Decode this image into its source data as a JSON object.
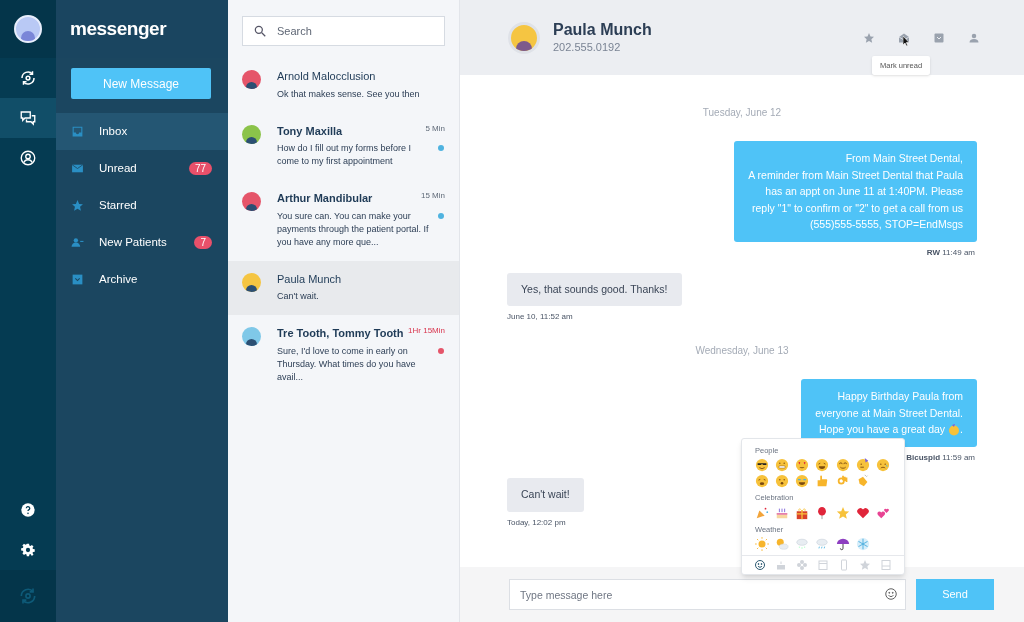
{
  "rail": {
    "items": [
      {
        "kind": "sync",
        "selected": false
      },
      {
        "kind": "chat",
        "selected": true
      },
      {
        "kind": "profile",
        "selected": false
      }
    ],
    "bottom": [
      {
        "kind": "help"
      },
      {
        "kind": "settings"
      }
    ]
  },
  "nav": {
    "logo": "messenger",
    "new_button": "New Message",
    "items": [
      {
        "kind": "inbox",
        "label": "Inbox",
        "selected": true
      },
      {
        "kind": "unread",
        "label": "Unread",
        "badge": "77",
        "selected": false
      },
      {
        "kind": "starred",
        "label": "Starred",
        "selected": false
      },
      {
        "kind": "patients",
        "label": "New Patients",
        "badge": "7",
        "selected": false
      },
      {
        "kind": "archive",
        "label": "Archive",
        "selected": false
      }
    ]
  },
  "conversations": {
    "search": {
      "placeholder": "Search"
    },
    "items": [
      {
        "name": "Arnold Malocclusion",
        "preview": "Ok that makes sense. See you then",
        "color": "#e5556a",
        "unread": false,
        "selected": false
      },
      {
        "name": "Tony Maxilla",
        "preview": "How do I fill out my forms before I come to my first appointment",
        "time": "5 Min",
        "time_urgent": false,
        "color": "#8bc34a",
        "unread": true,
        "unread_dot": {
          "color": "#4fb3e0"
        },
        "selected": false
      },
      {
        "name": "Arthur Mandibular",
        "preview": "You sure can. You can make your payments through the patient portal. If you have any more que...",
        "time": "15 Min",
        "time_urgent": false,
        "color": "#e5556a",
        "unread": true,
        "unread_dot": {
          "color": "#4fb3e0"
        },
        "selected": false
      },
      {
        "name": "Paula Munch",
        "preview": "Can't wait.",
        "color": "#f5c542",
        "unread": false,
        "selected": true
      },
      {
        "name": "Tre Tooth, Tommy Tooth",
        "preview": "Sure, I'd love to come in early on Thursday. What times do you have avail...",
        "time": "1Hr 15Min",
        "color": "#7fc8e8",
        "unread": true,
        "unread_dot": {
          "color": "#e5556a"
        },
        "time_urgent": true,
        "selected": false
      }
    ]
  },
  "chat": {
    "contact": {
      "name": "Paula Munch",
      "phone": "202.555.0192"
    },
    "actions": [
      {
        "kind": "star"
      },
      {
        "kind": "mark-unread"
      },
      {
        "kind": "archive"
      },
      {
        "kind": "profile"
      }
    ],
    "tooltip": "Mark unread",
    "messages": [
      {
        "kind": "date",
        "text": "Tuesday, June 12"
      },
      {
        "kind": "out",
        "lines": [
          "From Main Street Dental,",
          "A reminder from Main Street Dental that Paula",
          "has an appt on June 11 at 1:40PM. Please",
          "reply \"1\" to confirm or  \"2\" to get a call from us",
          "(555)555-5555, STOP=EndMsgs"
        ],
        "sender": "RW",
        "time": "11:49 am"
      },
      {
        "kind": "in",
        "text": "Yes, that sounds good. Thanks!",
        "time": "June 10, 11:52 am"
      },
      {
        "kind": "date",
        "text": "Wednesday, June 13"
      },
      {
        "kind": "out",
        "lines": [
          "Happy Birthday Paula from",
          "everyone at Main Street Dental.",
          "Hope you have a great day"
        ],
        "emoji_end": ".",
        "sender": "Bicuspid",
        "time": "11:59 am"
      },
      {
        "kind": "in",
        "text": "Can't wait!",
        "time": "Today, 12:02 pm"
      }
    ],
    "emoji_picker": {
      "sections": [
        "People",
        "Celebration",
        "Weather"
      ],
      "tabs": [
        {
          "selected": true
        },
        {
          "selected": false
        },
        {
          "selected": false
        },
        {
          "selected": false
        },
        {
          "selected": false
        },
        {
          "selected": false
        },
        {
          "selected": false
        }
      ]
    },
    "compose": {
      "placeholder": "Type message here",
      "send": "Send"
    }
  }
}
